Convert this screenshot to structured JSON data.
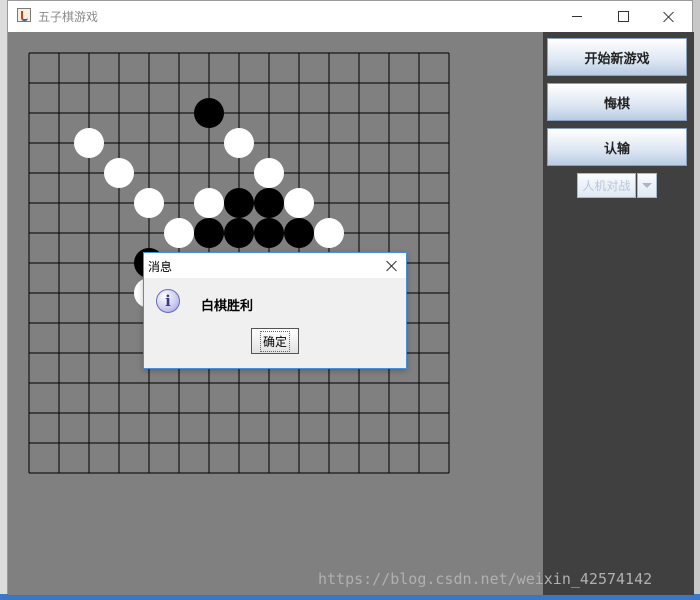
{
  "window": {
    "title": "五子棋游戏"
  },
  "board": {
    "rows": 14,
    "cols": 14,
    "stones": [
      {
        "col": 6,
        "row": 2,
        "color": "black"
      },
      {
        "col": 2,
        "row": 3,
        "color": "white"
      },
      {
        "col": 7,
        "row": 3,
        "color": "white"
      },
      {
        "col": 3,
        "row": 4,
        "color": "white"
      },
      {
        "col": 8,
        "row": 4,
        "color": "white"
      },
      {
        "col": 4,
        "row": 5,
        "color": "white"
      },
      {
        "col": 6,
        "row": 5,
        "color": "white"
      },
      {
        "col": 7,
        "row": 5,
        "color": "black"
      },
      {
        "col": 8,
        "row": 5,
        "color": "black"
      },
      {
        "col": 9,
        "row": 5,
        "color": "white"
      },
      {
        "col": 5,
        "row": 6,
        "color": "white"
      },
      {
        "col": 6,
        "row": 6,
        "color": "black"
      },
      {
        "col": 7,
        "row": 6,
        "color": "black"
      },
      {
        "col": 8,
        "row": 6,
        "color": "black"
      },
      {
        "col": 9,
        "row": 6,
        "color": "black"
      },
      {
        "col": 10,
        "row": 6,
        "color": "white"
      },
      {
        "col": 4,
        "row": 7,
        "color": "black"
      },
      {
        "col": 4,
        "row": 8,
        "color": "white"
      }
    ]
  },
  "side_panel": {
    "new_game": "开始新游戏",
    "undo": "悔棋",
    "resign": "认输",
    "mode": "人机对战"
  },
  "dialog": {
    "title": "消息",
    "message": "白棋胜利",
    "ok": "确定"
  },
  "watermark": "https://blog.csdn.net/weixin_42574142"
}
